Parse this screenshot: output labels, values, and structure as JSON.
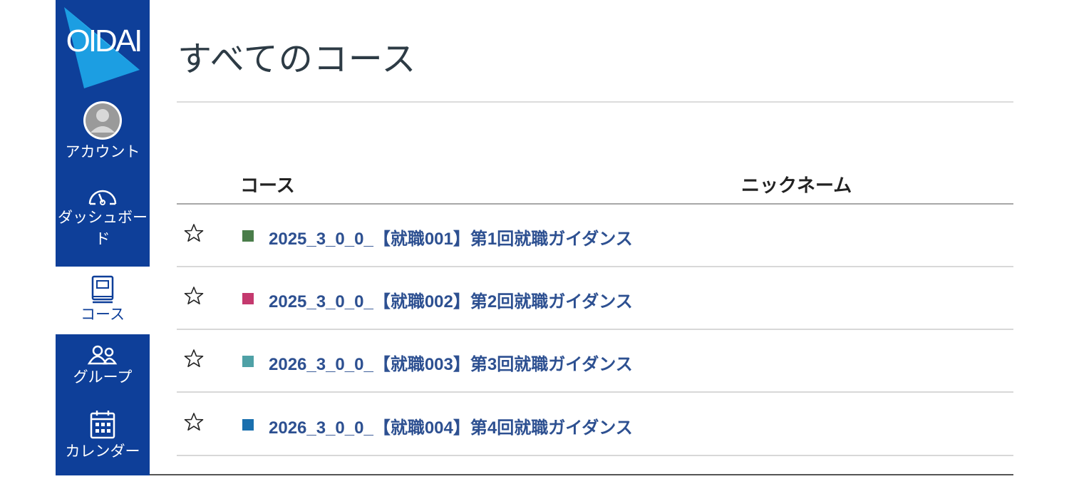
{
  "logo": {
    "text": "OIDAI"
  },
  "nav": [
    {
      "label": "アカウント",
      "icon": "avatar-icon"
    },
    {
      "label": "ダッシュボード",
      "icon": "dashboard-gauge-icon"
    },
    {
      "label": "コース",
      "icon": "book-icon"
    },
    {
      "label": "グループ",
      "icon": "people-icon"
    },
    {
      "label": "カレンダー",
      "icon": "calendar-icon"
    }
  ],
  "page": {
    "title": "すべてのコース"
  },
  "table": {
    "headers": {
      "course": "コース",
      "nickname": "ニックネーム"
    },
    "rows": [
      {
        "name": "2025_3_0_0_【就職001】第1回就職ガイダンス",
        "color": "#4a7d4a",
        "nickname": ""
      },
      {
        "name": "2025_3_0_0_【就職002】第2回就職ガイダンス",
        "color": "#c4396e",
        "nickname": ""
      },
      {
        "name": "2026_3_0_0_【就職003】第3回就職ガイダンス",
        "color": "#4fa1a6",
        "nickname": ""
      },
      {
        "name": "2026_3_0_0_【就職004】第4回就職ガイダンス",
        "color": "#1a6fae",
        "nickname": ""
      }
    ]
  },
  "colors": {
    "sidebar": "#0e3f99",
    "link": "#2d5091",
    "logo_accent": "#1ea3e6"
  }
}
